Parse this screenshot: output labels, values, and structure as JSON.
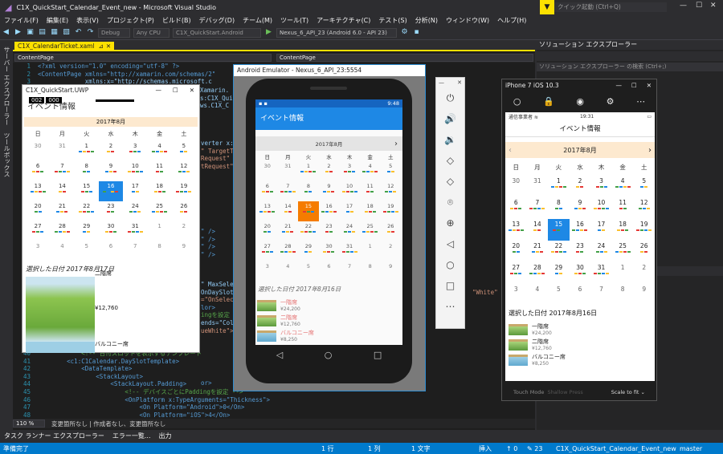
{
  "vs": {
    "title": "C1X_QuickStart_Calendar_Event_new - Microsoft Visual Studio",
    "quick_launch": "クイック起動 (Ctrl+Q)",
    "menu": [
      "ファイル(F)",
      "編集(E)",
      "表示(V)",
      "プロジェクト(P)",
      "ビルド(B)",
      "デバッグ(D)",
      "チーム(M)",
      "ツール(T)",
      "アーキテクチャ(C)",
      "テスト(S)",
      "分析(N)",
      "ウィンドウ(W)",
      "ヘルプ(H)"
    ],
    "toolbar": {
      "config": "Debug",
      "platform": "Any CPU",
      "project": "C1X_QuickStart.Android",
      "device": "Nexus_6_API_23 (Android 6.0 - API 23)"
    },
    "doc_tab": "C1X_CalendarTicket.xaml",
    "nav_left": "ContentPage",
    "nav_right": "ContentPage",
    "zoom": "110 %",
    "changes": "変更箇所なし | 作成者なし、変更箇所なし",
    "left_tabs": [
      "サーバー エクスプローラー",
      "ツールボックス"
    ],
    "bottom_tabs": [
      "タスク ランナー エクスプローラー",
      "エラー一覧...",
      "出力"
    ],
    "status": {
      "ready": "準備完了",
      "ln": "1 行",
      "col": "1 列",
      "ch": "1 文字",
      "ins": "挿入",
      "up": "↑ 0",
      "edits": "✎ 23",
      "repo": "C1X_QuickStart_Calendar_Event_new",
      "branch": "master"
    },
    "solution_title": "ソリューション エクスプローラー",
    "solution_search": "ソリューション エクスプローラー の検索 (Ctrl+;)"
  },
  "code_top": [
    {
      "n": "1",
      "t": "<?xml version=\"1.0\" encoding=\"utf-8\" ?>"
    },
    {
      "n": "2",
      "t": "<ContentPage xmlns=\"http://xamarin.com/schemas/2\""
    },
    {
      "n": "3",
      "t": "             xmlns:x=\"http://schemas.microsoft.c"
    }
  ],
  "code_frag": [
    "verter x:",
    "\" TargetT",
    "Request\"",
    "tRequest\"",
    "\" />",
    "\" />",
    "\" />",
    "\" />",
    "\" MaxSele",
    "OnDaySlot",
    "=\"OnSelec",
    "lor>",
    "ingを設定",
    "ends=\"Col",
    "ueWhite\">",
    "or>"
  ],
  "code_frag2": [
    "Xamarin.",
    "s:C1X_Quic",
    "ws.C1X_C"
  ],
  "code_right": "\"White\" Head",
  "code_bottom": [
    {
      "n": "40",
      "t": "        <!-- 日付スロットを表示するテンプレート"
    },
    {
      "n": "41",
      "t": "        <c1:C1Calendar.DaySlotTemplate>"
    },
    {
      "n": "42",
      "t": "            <DataTemplate>"
    },
    {
      "n": "43",
      "t": "                <StackLayout>"
    },
    {
      "n": "44",
      "t": "                    <StackLayout.Padding>"
    },
    {
      "n": "45",
      "t": "                        <!-- デバイスごとにPaddingを設定 -->"
    },
    {
      "n": "46",
      "t": "                        <OnPlatform x:TypeArguments=\"Thickness\">"
    },
    {
      "n": "47",
      "t": "                            <On Platform=\"Android\">0</On>"
    },
    {
      "n": "48",
      "t": "                            <On Platform=\"iOS\">4</On>"
    }
  ],
  "uwp": {
    "title": "C1X_QuickStart.UWP",
    "badge": [
      "002",
      "000"
    ],
    "page_title": "イベント情報",
    "month": "2017年8月",
    "dow": [
      "日",
      "月",
      "火",
      "水",
      "木",
      "金",
      "土"
    ],
    "days": [
      "30",
      "31",
      "1",
      "2",
      "3",
      "4",
      "5",
      "6",
      "7",
      "8",
      "9",
      "10",
      "11",
      "12",
      "13",
      "14",
      "15",
      "16",
      "17",
      "18",
      "19",
      "20",
      "21",
      "22",
      "23",
      "24",
      "25",
      "26",
      "27",
      "28",
      "29",
      "30",
      "31",
      "1",
      "2",
      "3",
      "4",
      "5",
      "6",
      "7",
      "8",
      "9"
    ],
    "selected_label": "選択した日付 2017年8月17日",
    "item1": "二階席",
    "price1": "¥12,760",
    "item2": "バルコニー席"
  },
  "emu": {
    "title": "Android Emulator - Nexus_6_API_23:5554",
    "time": "9:48",
    "app_title": "イベント情報",
    "month": "2017年8月",
    "dow": [
      "日",
      "月",
      "火",
      "水",
      "木",
      "金",
      "土"
    ],
    "days": [
      "30",
      "31",
      "1",
      "2",
      "3",
      "4",
      "5",
      "6",
      "7",
      "8",
      "9",
      "10",
      "11",
      "12",
      "13",
      "14",
      "15",
      "16",
      "17",
      "18",
      "19",
      "20",
      "21",
      "22",
      "23",
      "24",
      "25",
      "26",
      "27",
      "28",
      "29",
      "30",
      "31",
      "1",
      "2",
      "3",
      "4",
      "5",
      "6",
      "7",
      "8",
      "9"
    ],
    "selected_label": "選択した日付 2017年8月16日",
    "items": [
      {
        "name": "一階席",
        "price": "¥24,200"
      },
      {
        "name": "二階席",
        "price": "¥12,760"
      },
      {
        "name": "バルコニー席",
        "price": "¥8,250"
      }
    ],
    "nav": [
      "◁",
      "○",
      "□"
    ]
  },
  "emu_ctl": [
    "⏻",
    "🔊",
    "🔉",
    "◇",
    "◇",
    "⌾",
    "⊕",
    "◁",
    "○",
    "□",
    "⋯"
  ],
  "ios": {
    "title": "iPhone 7 iOS 10.3",
    "carrier": "通信事業者 ≋",
    "time": "19:31",
    "app_title": "イベント情報",
    "month": "2017年8月",
    "dow": [
      "日",
      "月",
      "火",
      "水",
      "木",
      "金",
      "土"
    ],
    "days": [
      "30",
      "31",
      "1",
      "2",
      "3",
      "4",
      "5",
      "6",
      "7",
      "8",
      "9",
      "10",
      "11",
      "12",
      "13",
      "14",
      "15",
      "16",
      "17",
      "18",
      "19",
      "20",
      "21",
      "22",
      "23",
      "24",
      "25",
      "26",
      "27",
      "28",
      "29",
      "30",
      "31",
      "1",
      "2",
      "3",
      "4",
      "5",
      "6",
      "7",
      "8",
      "9"
    ],
    "selected_label": "選択した日付 2017年8月16日",
    "items": [
      {
        "name": "一階席",
        "price": "¥24,200"
      },
      {
        "name": "二階席",
        "price": "¥12,760"
      },
      {
        "name": "バルコニー席",
        "price": "¥8,250"
      }
    ],
    "touch_mode": "Touch Mode",
    "shallow": "Shallow Press",
    "scale": "Scale to fit ⌄"
  },
  "colors": {
    "accent": "#007acc",
    "android_bar": "#1e88e5",
    "android_sel": "#f57c00",
    "uwp_sel": "#1e88e5",
    "ios_sel": "#1e88e5",
    "month_bar": "#fde9cf"
  }
}
